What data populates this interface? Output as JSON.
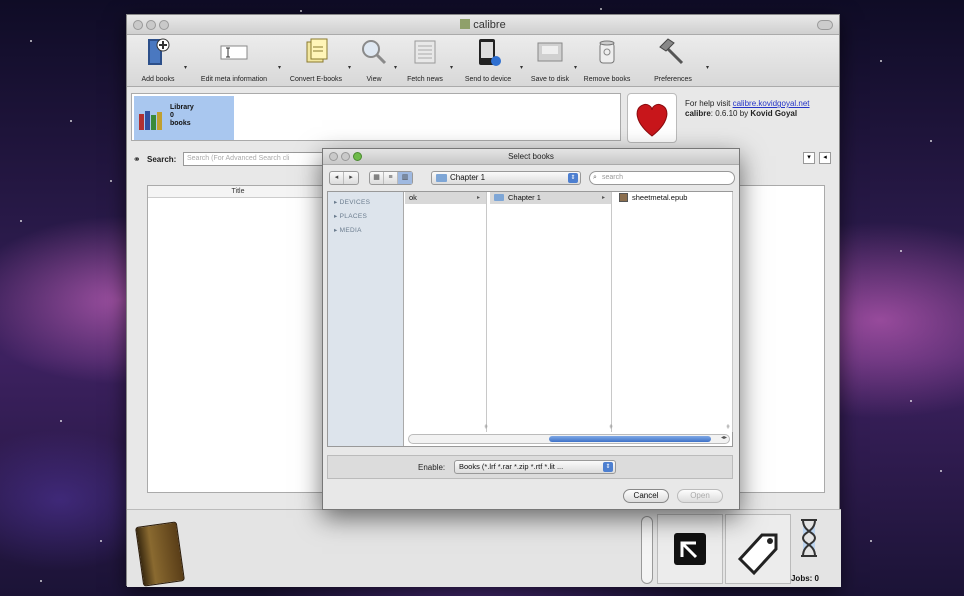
{
  "window": {
    "title": "calibre"
  },
  "toolbar": {
    "items": [
      {
        "label": "Add books",
        "icon": "add-books-icon"
      },
      {
        "label": "Edit meta information",
        "icon": "edit-meta-icon"
      },
      {
        "label": "Convert E-books",
        "icon": "convert-icon"
      },
      {
        "label": "View",
        "icon": "magnifier-icon"
      },
      {
        "label": "Fetch news",
        "icon": "news-icon"
      },
      {
        "label": "Send to device",
        "icon": "device-icon"
      },
      {
        "label": "Save to disk",
        "icon": "disk-icon"
      },
      {
        "label": "Remove books",
        "icon": "trash-icon"
      },
      {
        "label": "Preferences",
        "icon": "hammer-icon"
      }
    ]
  },
  "library": {
    "name": "Library",
    "count": "0",
    "unit": "books"
  },
  "help": {
    "prefix": "For help visit ",
    "link": "calibre.kovidgoyal.net",
    "app": "calibre",
    "version": ": 0.6.10 by ",
    "author": "Kovid Goyal"
  },
  "search": {
    "label": "Search:",
    "placeholder": "Search (For Advanced Search cli"
  },
  "table": {
    "column_title": "Title"
  },
  "status": {
    "jobs": "Jobs: 0"
  },
  "dialog": {
    "title": "Select books",
    "location": "Chapter 1",
    "search_placeholder": "search",
    "sidebar": [
      "DEVICES",
      "PLACES",
      "MEDIA"
    ],
    "columns": [
      {
        "items": [
          {
            "label": "ok"
          }
        ]
      },
      {
        "items": [
          {
            "label": "Chapter 1",
            "type": "folder"
          }
        ]
      },
      {
        "items": [
          {
            "label": "sheetmetal.epub",
            "type": "file"
          }
        ]
      }
    ],
    "enable_label": "Enable:",
    "enable_value": "Books (*.lrf *.rar *.zip *.rtf *.lit ...",
    "cancel": "Cancel",
    "open": "Open"
  },
  "colors": {
    "selection": "#a9c7ef",
    "accent": "#4d7fd0",
    "link": "#2434c8"
  }
}
